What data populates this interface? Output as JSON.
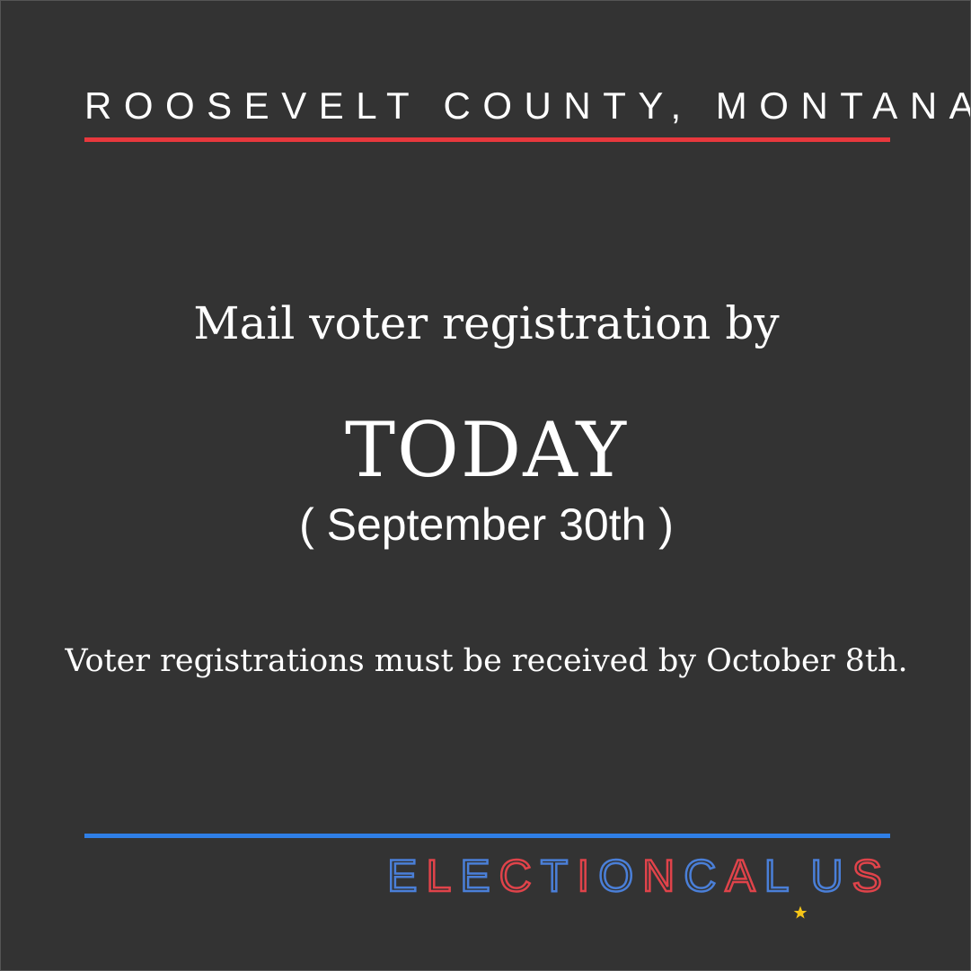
{
  "header": {
    "county": "ROOSEVELT COUNTY, MONTANA"
  },
  "main": {
    "headline": "Mail voter registration by",
    "deadline_word": "TODAY",
    "deadline_date": "( September 30th )",
    "note": "Voter registrations must be received by October 8th."
  },
  "footer": {
    "brand": "ELECTIONCAL.US",
    "brand_parts": {
      "name": "ELECTIONCAL",
      "tld": "US"
    }
  },
  "colors": {
    "background": "#333333",
    "top_rule": "#e8383d",
    "bottom_rule": "#2f7fe6",
    "brand_red": "#e0434a",
    "brand_blue": "#4a7fd8",
    "star": "#f5c518",
    "text": "#ffffff"
  },
  "icons": {
    "brand_separator": "star-icon"
  }
}
